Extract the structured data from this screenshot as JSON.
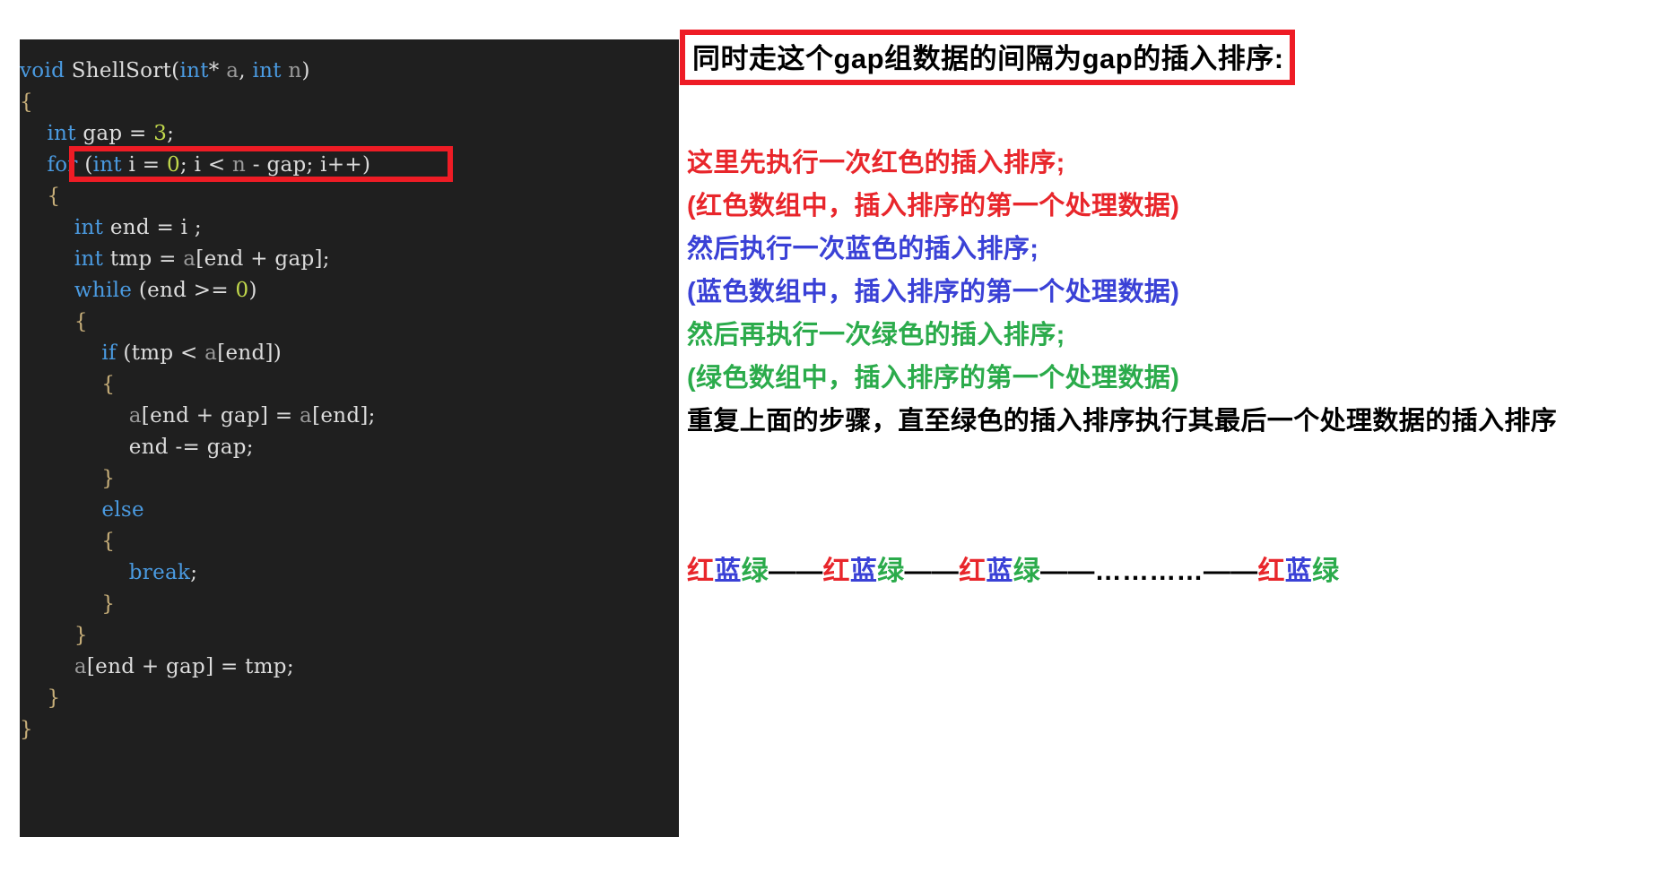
{
  "code_panel": {
    "language": "cpp",
    "background": "#1f1f1f",
    "lines": [
      {
        "indent": 0,
        "tokens": [
          {
            "t": "void ",
            "c": "type"
          },
          {
            "t": "ShellSort",
            "c": "plain"
          },
          {
            "t": "(",
            "c": "punct"
          },
          {
            "t": "int",
            "c": "type"
          },
          {
            "t": "* ",
            "c": "punct"
          },
          {
            "t": "a",
            "c": "var"
          },
          {
            "t": ", ",
            "c": "punct"
          },
          {
            "t": "int",
            "c": "type"
          },
          {
            "t": " ",
            "c": "punct"
          },
          {
            "t": "n",
            "c": "var"
          },
          {
            "t": ")",
            "c": "punct"
          }
        ]
      },
      {
        "indent": 0,
        "tokens": [
          {
            "t": "{",
            "c": "brace"
          }
        ]
      },
      {
        "indent": 1,
        "tokens": [
          {
            "t": "int",
            "c": "type"
          },
          {
            "t": " gap = ",
            "c": "plain"
          },
          {
            "t": "3",
            "c": "num"
          },
          {
            "t": ";",
            "c": "plain"
          }
        ]
      },
      {
        "indent": 1,
        "tokens": [
          {
            "t": "for",
            "c": "kw"
          },
          {
            "t": " (",
            "c": "punct"
          },
          {
            "t": "int",
            "c": "type"
          },
          {
            "t": " i = ",
            "c": "plain"
          },
          {
            "t": "0",
            "c": "num"
          },
          {
            "t": "; i < ",
            "c": "plain"
          },
          {
            "t": "n",
            "c": "var"
          },
          {
            "t": " - gap; i++)",
            "c": "plain"
          }
        ]
      },
      {
        "indent": 1,
        "tokens": [
          {
            "t": "{",
            "c": "brace"
          }
        ]
      },
      {
        "indent": 2,
        "tokens": [
          {
            "t": "int",
            "c": "type"
          },
          {
            "t": " end = i ;",
            "c": "plain"
          }
        ]
      },
      {
        "indent": 2,
        "tokens": [
          {
            "t": "int",
            "c": "type"
          },
          {
            "t": " tmp = ",
            "c": "plain"
          },
          {
            "t": "a",
            "c": "var"
          },
          {
            "t": "[end + gap];",
            "c": "plain"
          }
        ]
      },
      {
        "indent": 2,
        "tokens": [
          {
            "t": "while",
            "c": "kw"
          },
          {
            "t": " (end >= ",
            "c": "plain"
          },
          {
            "t": "0",
            "c": "num"
          },
          {
            "t": ")",
            "c": "plain"
          }
        ]
      },
      {
        "indent": 2,
        "tokens": [
          {
            "t": "{",
            "c": "brace"
          }
        ]
      },
      {
        "indent": 3,
        "tokens": [
          {
            "t": "if",
            "c": "kw"
          },
          {
            "t": " (tmp < ",
            "c": "plain"
          },
          {
            "t": "a",
            "c": "var"
          },
          {
            "t": "[end])",
            "c": "plain"
          }
        ]
      },
      {
        "indent": 3,
        "tokens": [
          {
            "t": "{",
            "c": "brace"
          }
        ]
      },
      {
        "indent": 4,
        "tokens": [
          {
            "t": "a",
            "c": "var"
          },
          {
            "t": "[end + gap] = ",
            "c": "plain"
          },
          {
            "t": "a",
            "c": "var"
          },
          {
            "t": "[end];",
            "c": "plain"
          }
        ]
      },
      {
        "indent": 4,
        "tokens": [
          {
            "t": "end -= gap;",
            "c": "plain"
          }
        ]
      },
      {
        "indent": 3,
        "tokens": [
          {
            "t": "}",
            "c": "brace"
          }
        ]
      },
      {
        "indent": 3,
        "tokens": [
          {
            "t": "else",
            "c": "kw"
          }
        ]
      },
      {
        "indent": 3,
        "tokens": [
          {
            "t": "{",
            "c": "brace"
          }
        ]
      },
      {
        "indent": 4,
        "tokens": [
          {
            "t": "break",
            "c": "kw"
          },
          {
            "t": ";",
            "c": "plain"
          }
        ]
      },
      {
        "indent": 3,
        "tokens": [
          {
            "t": "}",
            "c": "brace"
          }
        ]
      },
      {
        "indent": 2,
        "tokens": [
          {
            "t": "}",
            "c": "brace"
          }
        ]
      },
      {
        "indent": 2,
        "tokens": [
          {
            "t": "a",
            "c": "var"
          },
          {
            "t": "[end + gap] = tmp;",
            "c": "plain"
          }
        ]
      },
      {
        "indent": 1,
        "tokens": [
          {
            "t": "}",
            "c": "brace"
          }
        ]
      },
      {
        "indent": 0,
        "tokens": [
          {
            "t": "}",
            "c": "brace"
          }
        ]
      }
    ],
    "highlight": {
      "label": "for-loop-highlight",
      "color": "#ee1c25",
      "line_index": 3
    }
  },
  "notes_panel": {
    "title": "同时走这个gap组数据的间隔为gap的插入排序:",
    "title_border_color": "#ee1c25",
    "title_color": "#000000",
    "lines": [
      {
        "text": "这里先执行一次红色的插入排序;",
        "color": "#e8262b"
      },
      {
        "text": "(红色数组中，插入排序的第一个处理数据)",
        "color": "#e8262b"
      },
      {
        "text": "然后执行一次蓝色的插入排序;",
        "color": "#3a41d6"
      },
      {
        "text": "(蓝色数组中，插入排序的第一个处理数据)",
        "color": "#3a41d6"
      },
      {
        "text": "然后再执行一次绿色的插入排序;",
        "color": "#2bab4b"
      },
      {
        "text": "(绿色数组中，插入排序的第一个处理数据)",
        "color": "#2bab4b"
      },
      {
        "text": "重复上面的步骤，直至绿色的插入排序执行其最后一个处理数据的插入排序",
        "color": "#000000"
      }
    ],
    "sequence": [
      {
        "text": "红",
        "color": "#e8262b"
      },
      {
        "text": "蓝",
        "color": "#3a41d6"
      },
      {
        "text": "绿",
        "color": "#2bab4b"
      },
      {
        "text": "——",
        "color": "#000000"
      },
      {
        "text": "红",
        "color": "#e8262b"
      },
      {
        "text": "蓝",
        "color": "#3a41d6"
      },
      {
        "text": "绿",
        "color": "#2bab4b"
      },
      {
        "text": "——",
        "color": "#000000"
      },
      {
        "text": "红",
        "color": "#e8262b"
      },
      {
        "text": "蓝",
        "color": "#3a41d6"
      },
      {
        "text": "绿",
        "color": "#2bab4b"
      },
      {
        "text": "——",
        "color": "#000000"
      },
      {
        "text": "…………",
        "color": "#000000"
      },
      {
        "text": "——",
        "color": "#000000"
      },
      {
        "text": "红",
        "color": "#e8262b"
      },
      {
        "text": "蓝",
        "color": "#3a41d6"
      },
      {
        "text": "绿",
        "color": "#2bab4b"
      }
    ]
  }
}
